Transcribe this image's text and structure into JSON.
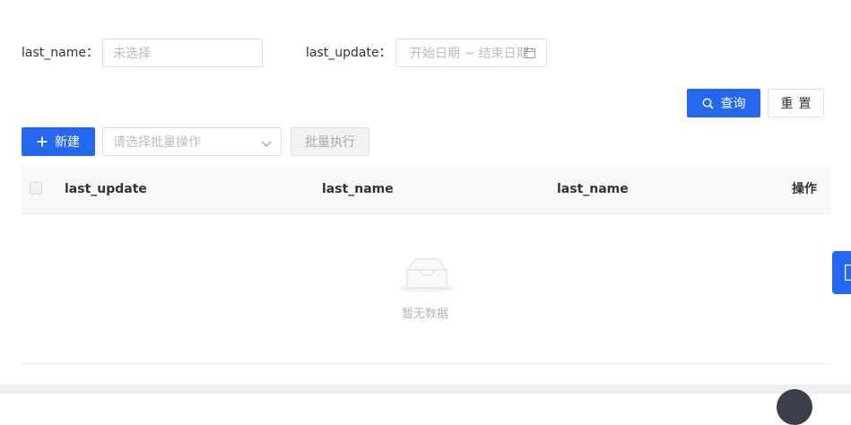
{
  "filters": {
    "last_name_label": "last_name：",
    "last_name_placeholder": "未选择",
    "last_update_label": "last_update：",
    "date_range_placeholder": "开始日期 ~ 结束日期"
  },
  "actions": {
    "search_label": "查询",
    "reset_label": "重置",
    "new_label": "新建",
    "batch_placeholder": "请选择批量操作",
    "batch_execute_label": "批量执行"
  },
  "table": {
    "columns": [
      "last_update",
      "last_name",
      "last_name",
      "操作"
    ],
    "empty_text": "暂无数据"
  },
  "colors": {
    "primary": "#2468f2"
  },
  "icons": {
    "search": "search-icon",
    "plus": "plus-icon",
    "calendar": "calendar-icon",
    "chevron": "chevron-down-icon",
    "empty": "empty-inbox-icon"
  }
}
